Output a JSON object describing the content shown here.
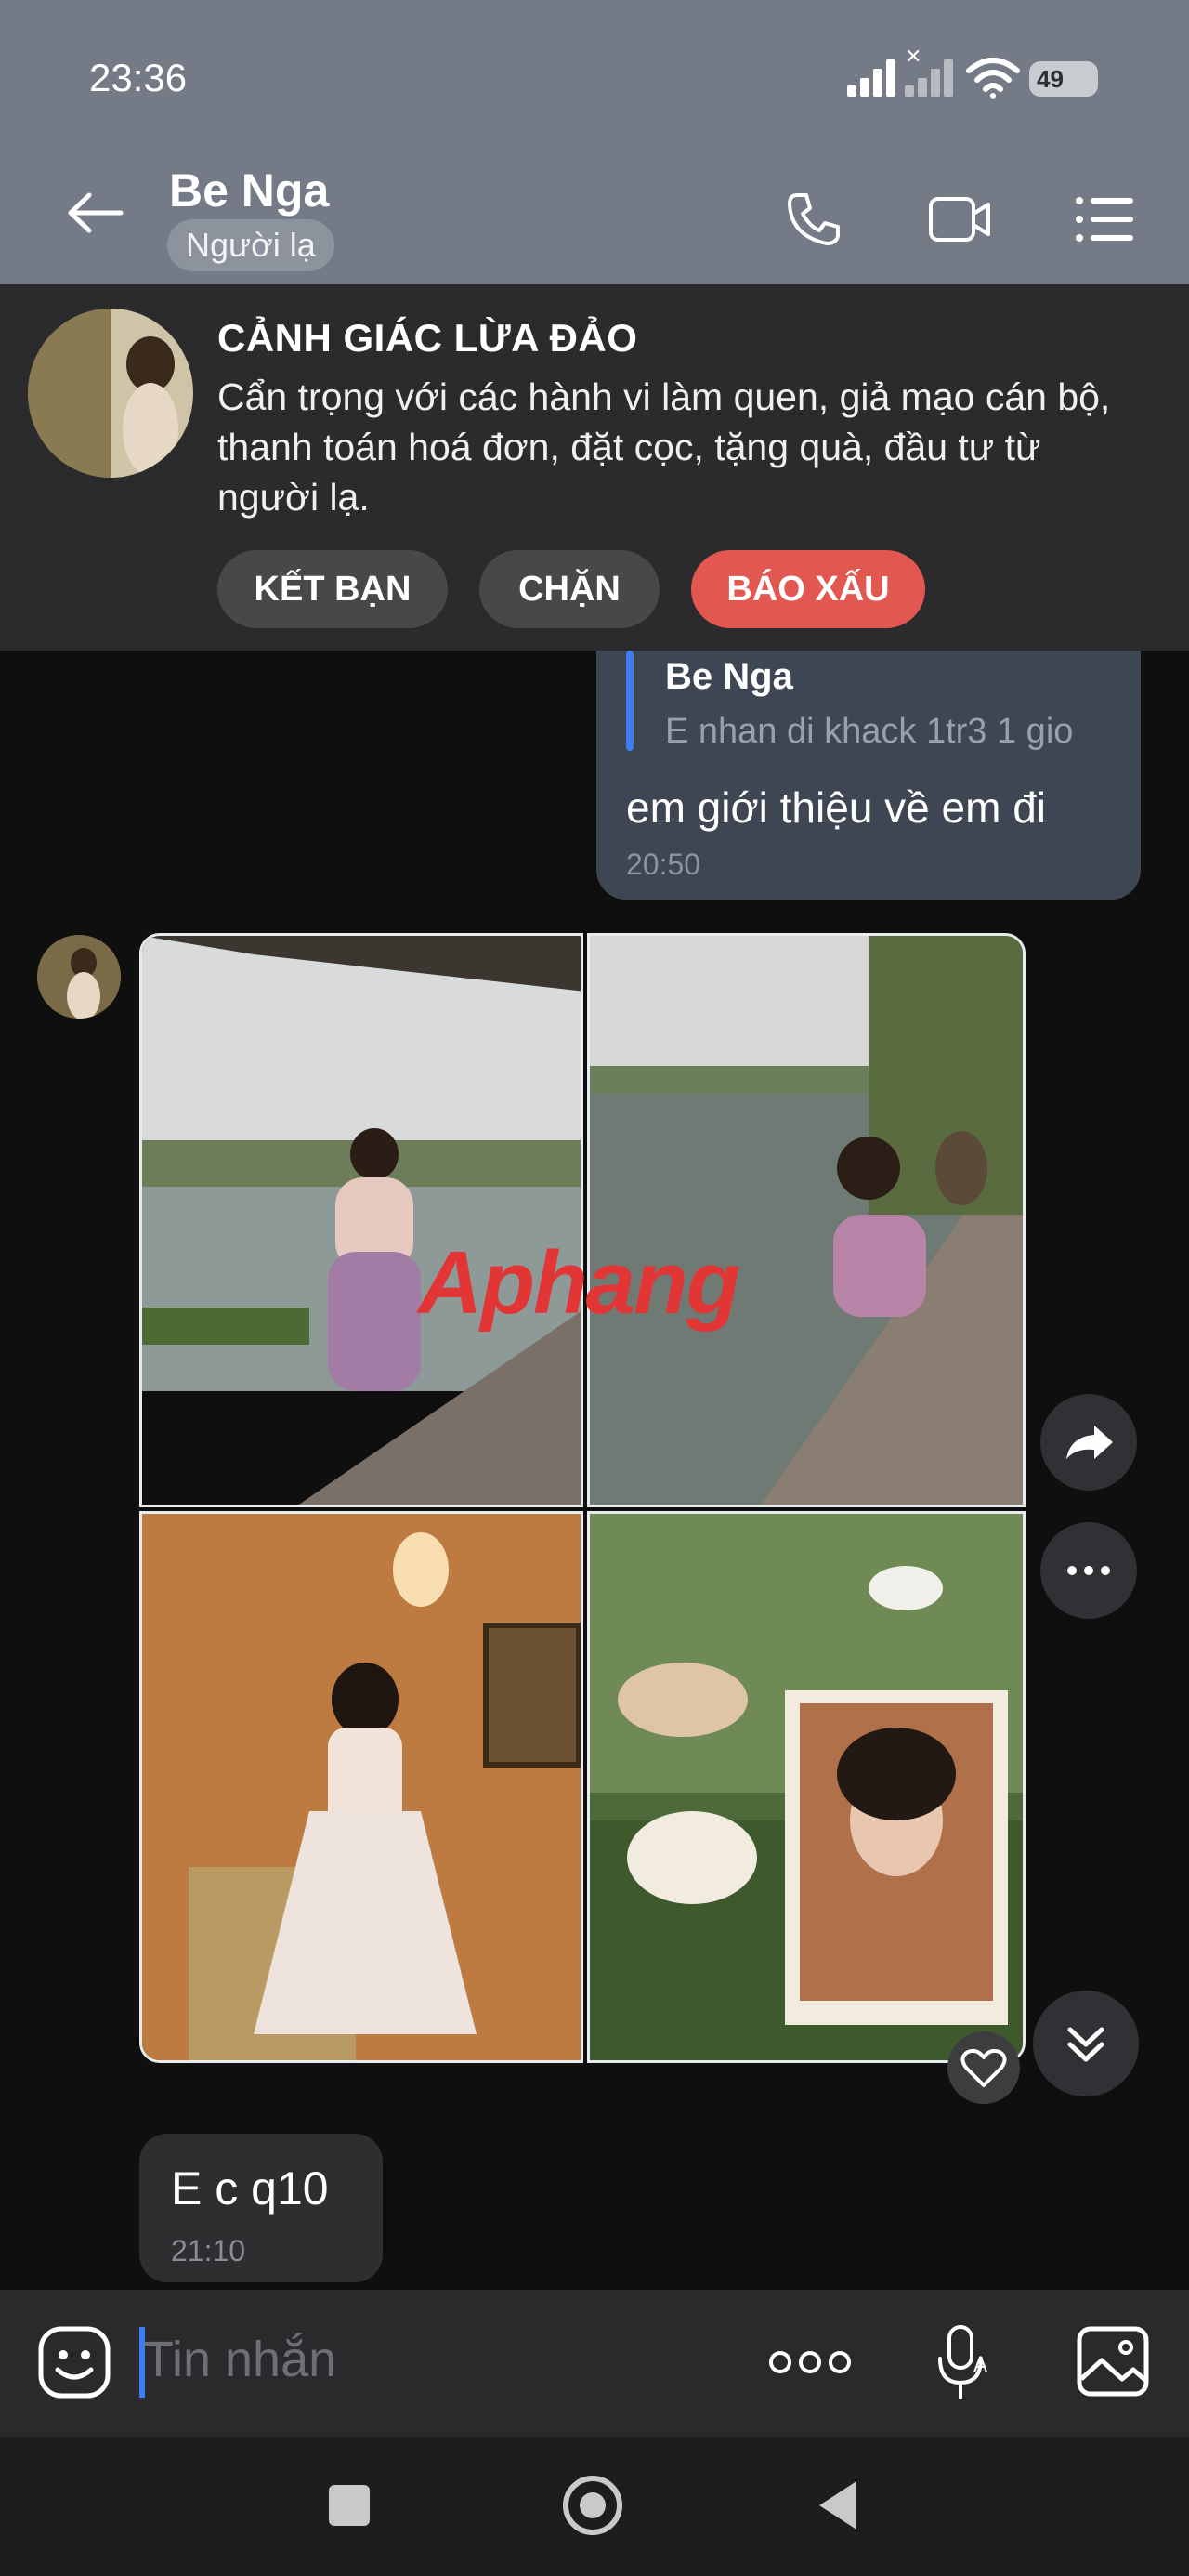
{
  "status_bar": {
    "time": "23:36",
    "battery": "49",
    "icons": [
      "signal-icon",
      "no-signal-icon",
      "wifi-icon",
      "battery-icon"
    ]
  },
  "header": {
    "contact_name": "Be Nga",
    "badge": "Người lạ",
    "icons": [
      "back-arrow-icon",
      "phone-icon",
      "video-call-icon",
      "menu-list-icon"
    ]
  },
  "warning": {
    "title": "CẢNH GIÁC LỪA ĐẢO",
    "text": "Cẩn trọng với các hành vi làm quen, giả mạo cán bộ, thanh toán hoá đơn, đặt cọc, tặng quà, đầu tư từ người lạ.",
    "buttons": {
      "add_friend": "KẾT BẠN",
      "block": "CHẶN",
      "report": "BÁO XẤU"
    }
  },
  "messages": {
    "outgoing": {
      "quote_name": "Be Nga",
      "quote_text": "E nhan di khack 1tr3 1 gio",
      "text": "em giới thiệu về em đi",
      "time": "20:50"
    },
    "photo_watermark": "Aphang",
    "incoming_text": {
      "text": "E c q10",
      "time": "21:10"
    }
  },
  "input": {
    "placeholder": "Tin nhắn",
    "icons": [
      "sticker-icon",
      "more-icon",
      "voice-icon",
      "image-icon"
    ]
  },
  "colors": {
    "header_bg": "#747a86",
    "report_red": "#e2574f",
    "accent_blue": "#3c7df2"
  }
}
